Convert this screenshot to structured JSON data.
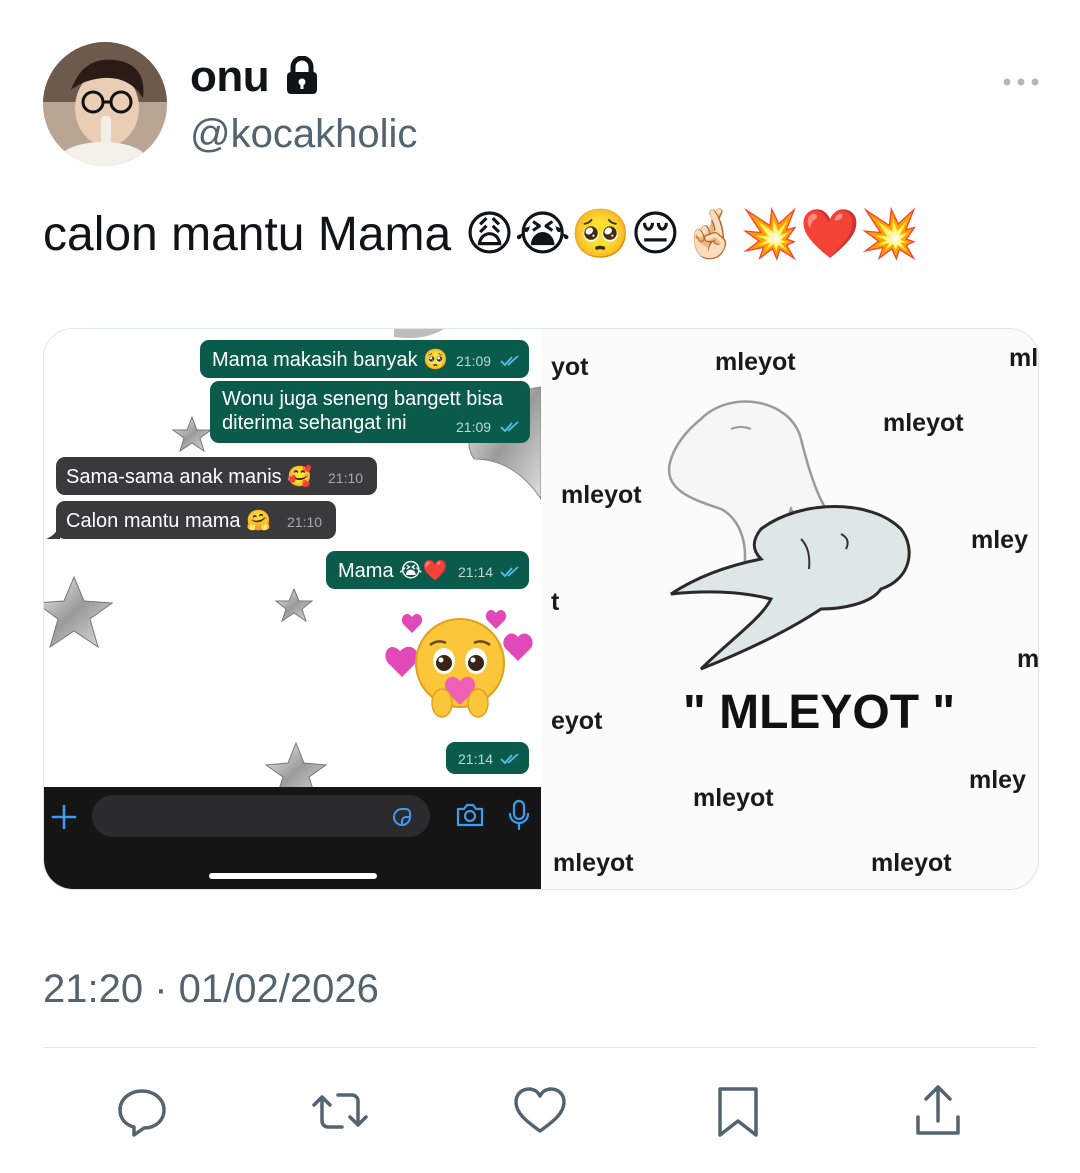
{
  "author": {
    "display_name": "onu",
    "handle": "@kocakholic",
    "protected_icon": "lock-icon",
    "avatar_icon": "avatar"
  },
  "tweet": {
    "text": "calon mantu Mama 😩😭🥺😔🤞🏻💥❤️💥",
    "timestamp": "21:20 · 01/02/2026"
  },
  "whatsapp": {
    "messages": [
      {
        "dir": "out",
        "text": "Mama makasih banyak 🥺",
        "time": "21:09"
      },
      {
        "dir": "out",
        "text_line1": "Wonu juga seneng bangett bisa",
        "text_line2": "diterima sehangat ini",
        "time": "21:09"
      },
      {
        "dir": "in",
        "text": "Sama-sama anak manis 🥰",
        "time": "21:10"
      },
      {
        "dir": "in",
        "text": "Calon mantu mama 🤗",
        "time": "21:10"
      },
      {
        "dir": "out",
        "text": "Mama 😭❤️",
        "time": "21:14"
      },
      {
        "dir": "out",
        "text": "🥹",
        "time": "21:14"
      }
    ],
    "composer_icons": [
      "plus-icon",
      "sticker-icon",
      "camera-icon",
      "microphone-icon"
    ]
  },
  "meme": {
    "caption": "\" MLEYOT \"",
    "words": [
      "yot",
      "mleyot",
      "ml",
      "mleyot",
      "mleyot",
      "mley",
      "t",
      "m",
      "eyot",
      "mley",
      "mleyot",
      "mleyot",
      "mleyot"
    ]
  },
  "actions": [
    "reply-icon",
    "retweet-icon",
    "like-icon",
    "bookmark-icon",
    "share-icon"
  ],
  "colors": {
    "whatsapp_out": "#0b5b4c",
    "whatsapp_in": "#3a3a3c",
    "secondary_text": "#536471",
    "icon": "#536471"
  }
}
